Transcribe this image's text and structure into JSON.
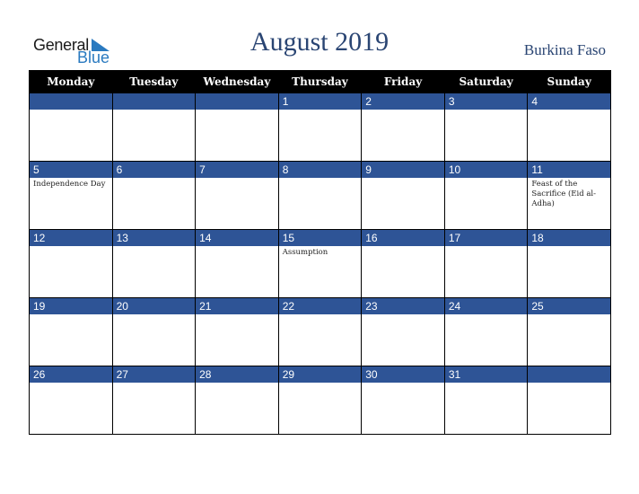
{
  "logo": {
    "line1": "General",
    "line2": "Blue"
  },
  "header": {
    "title": "August 2019",
    "country": "Burkina Faso"
  },
  "colors": {
    "accent": "#2e5496",
    "title": "#2a4573",
    "header_bg": "#000000",
    "logo_blue": "#2a7ac0"
  },
  "calendar": {
    "weekdays": [
      "Monday",
      "Tuesday",
      "Wednesday",
      "Thursday",
      "Friday",
      "Saturday",
      "Sunday"
    ],
    "weeks": [
      [
        {
          "day": "",
          "event": ""
        },
        {
          "day": "",
          "event": ""
        },
        {
          "day": "",
          "event": ""
        },
        {
          "day": "1",
          "event": ""
        },
        {
          "day": "2",
          "event": ""
        },
        {
          "day": "3",
          "event": ""
        },
        {
          "day": "4",
          "event": ""
        }
      ],
      [
        {
          "day": "5",
          "event": "Independence Day"
        },
        {
          "day": "6",
          "event": ""
        },
        {
          "day": "7",
          "event": ""
        },
        {
          "day": "8",
          "event": ""
        },
        {
          "day": "9",
          "event": ""
        },
        {
          "day": "10",
          "event": ""
        },
        {
          "day": "11",
          "event": "Feast of the Sacrifice (Eid al-Adha)"
        }
      ],
      [
        {
          "day": "12",
          "event": ""
        },
        {
          "day": "13",
          "event": ""
        },
        {
          "day": "14",
          "event": ""
        },
        {
          "day": "15",
          "event": "Assumption"
        },
        {
          "day": "16",
          "event": ""
        },
        {
          "day": "17",
          "event": ""
        },
        {
          "day": "18",
          "event": ""
        }
      ],
      [
        {
          "day": "19",
          "event": ""
        },
        {
          "day": "20",
          "event": ""
        },
        {
          "day": "21",
          "event": ""
        },
        {
          "day": "22",
          "event": ""
        },
        {
          "day": "23",
          "event": ""
        },
        {
          "day": "24",
          "event": ""
        },
        {
          "day": "25",
          "event": ""
        }
      ],
      [
        {
          "day": "26",
          "event": ""
        },
        {
          "day": "27",
          "event": ""
        },
        {
          "day": "28",
          "event": ""
        },
        {
          "day": "29",
          "event": ""
        },
        {
          "day": "30",
          "event": ""
        },
        {
          "day": "31",
          "event": ""
        },
        {
          "day": "",
          "event": ""
        }
      ]
    ]
  }
}
